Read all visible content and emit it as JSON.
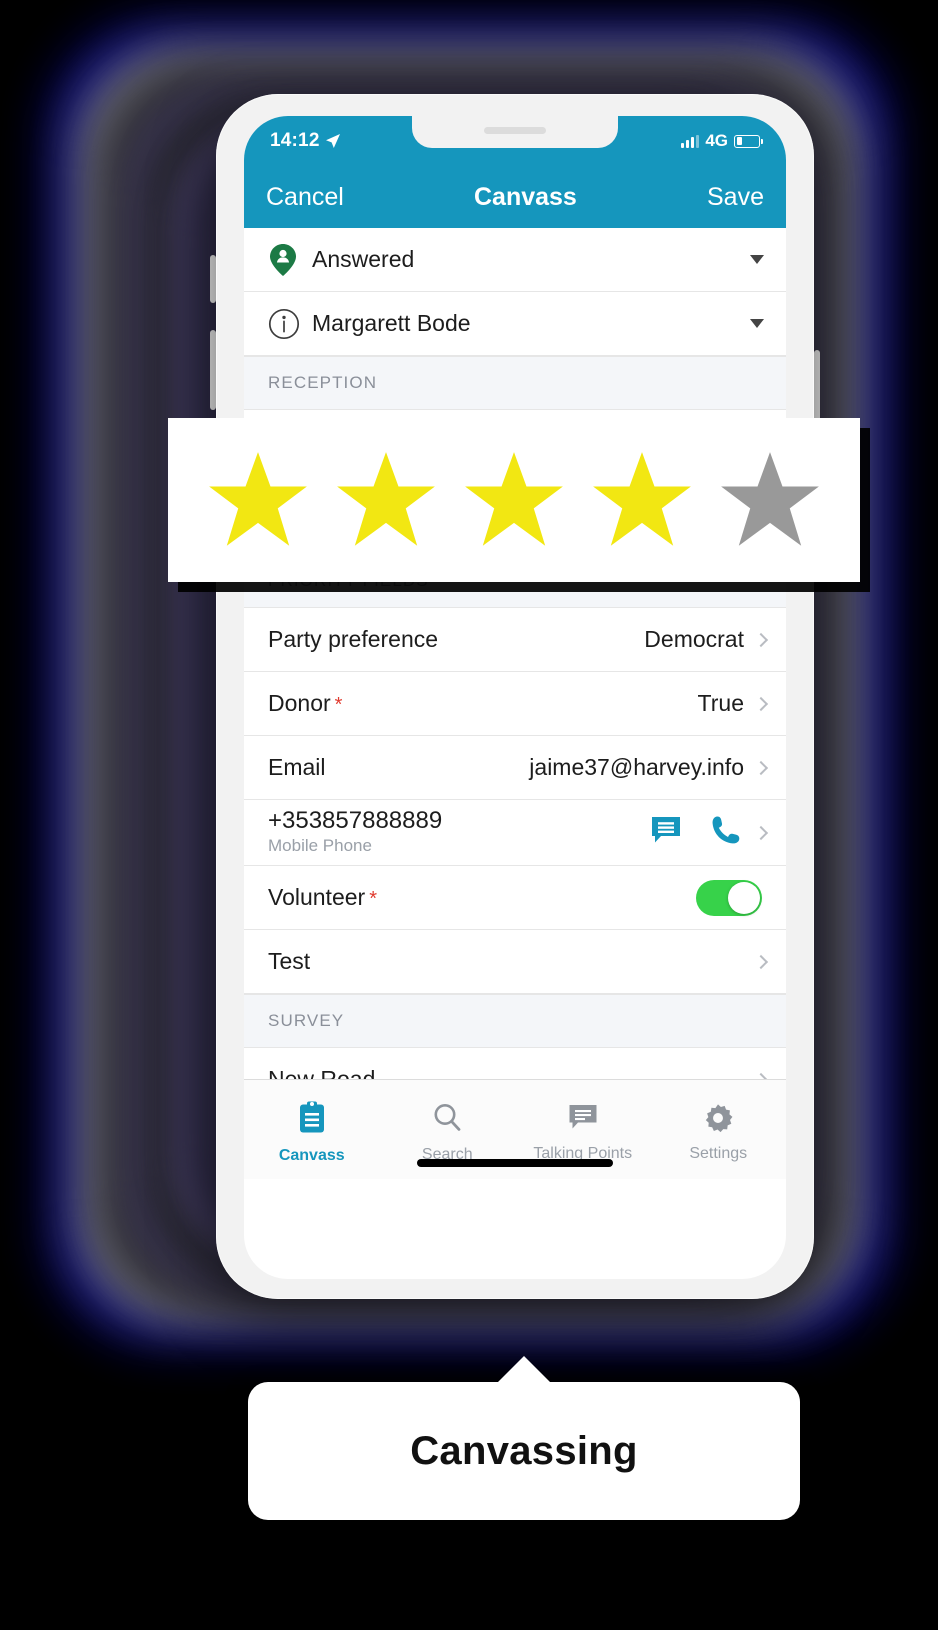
{
  "status_bar": {
    "time": "14:12",
    "location_icon": "location-arrow-icon",
    "network": "4G",
    "signal_icon": "signal-bars-icon",
    "battery_icon": "battery-icon"
  },
  "nav_bar": {
    "cancel_label": "Cancel",
    "title": "Canvass",
    "save_label": "Save"
  },
  "pickers": [
    {
      "label": "Answered",
      "icon": "map-pin-person-icon",
      "icon_color": "#1c7a45"
    },
    {
      "label": "Margarett Bode",
      "icon": "info-circle-icon",
      "icon_color": "#3c3c3c"
    }
  ],
  "sections": [
    {
      "title": "RECEPTION"
    },
    {
      "title": "PRIORITY FIELDS"
    },
    {
      "title": "SURVEY"
    }
  ],
  "rating": {
    "section": "RECEPTION",
    "value": 4,
    "max": 5,
    "filled_color": "#f2e712",
    "empty_color": "#999999"
  },
  "priority_fields": [
    {
      "label": "Party preference",
      "value": "Democrat",
      "required": false,
      "type": "chevron"
    },
    {
      "label": "Donor",
      "value": "True",
      "required": true,
      "type": "chevron"
    },
    {
      "label": "Email",
      "value": "jaime37@harvey.info",
      "required": false,
      "type": "chevron"
    },
    {
      "label": "+353857888889",
      "sublabel": "Mobile Phone",
      "required": false,
      "type": "phone",
      "actions": [
        "message-icon",
        "phone-icon"
      ]
    },
    {
      "label": "Volunteer",
      "value": "",
      "required": true,
      "type": "toggle",
      "toggle_on": true
    },
    {
      "label": "Test",
      "value": "",
      "required": false,
      "type": "chevron"
    }
  ],
  "survey_fields": [
    {
      "label": "New Road",
      "value": "",
      "required": false,
      "type": "chevron"
    }
  ],
  "tab_bar": [
    {
      "label": "Canvass",
      "icon": "clipboard-icon",
      "active": true
    },
    {
      "label": "Search",
      "icon": "search-icon",
      "active": false
    },
    {
      "label": "Talking Points",
      "icon": "speech-bubble-icon",
      "active": false
    },
    {
      "label": "Settings",
      "icon": "gear-icon",
      "active": false
    }
  ],
  "caption": {
    "text": "Canvassing"
  },
  "colors": {
    "accent": "#1596bd",
    "toggle_on": "#37d24a",
    "required_star": "#e03b2f",
    "section_bg": "#f4f6f9",
    "glow_blue": "#0d0d8f",
    "glow_purple": "#3d3757"
  }
}
